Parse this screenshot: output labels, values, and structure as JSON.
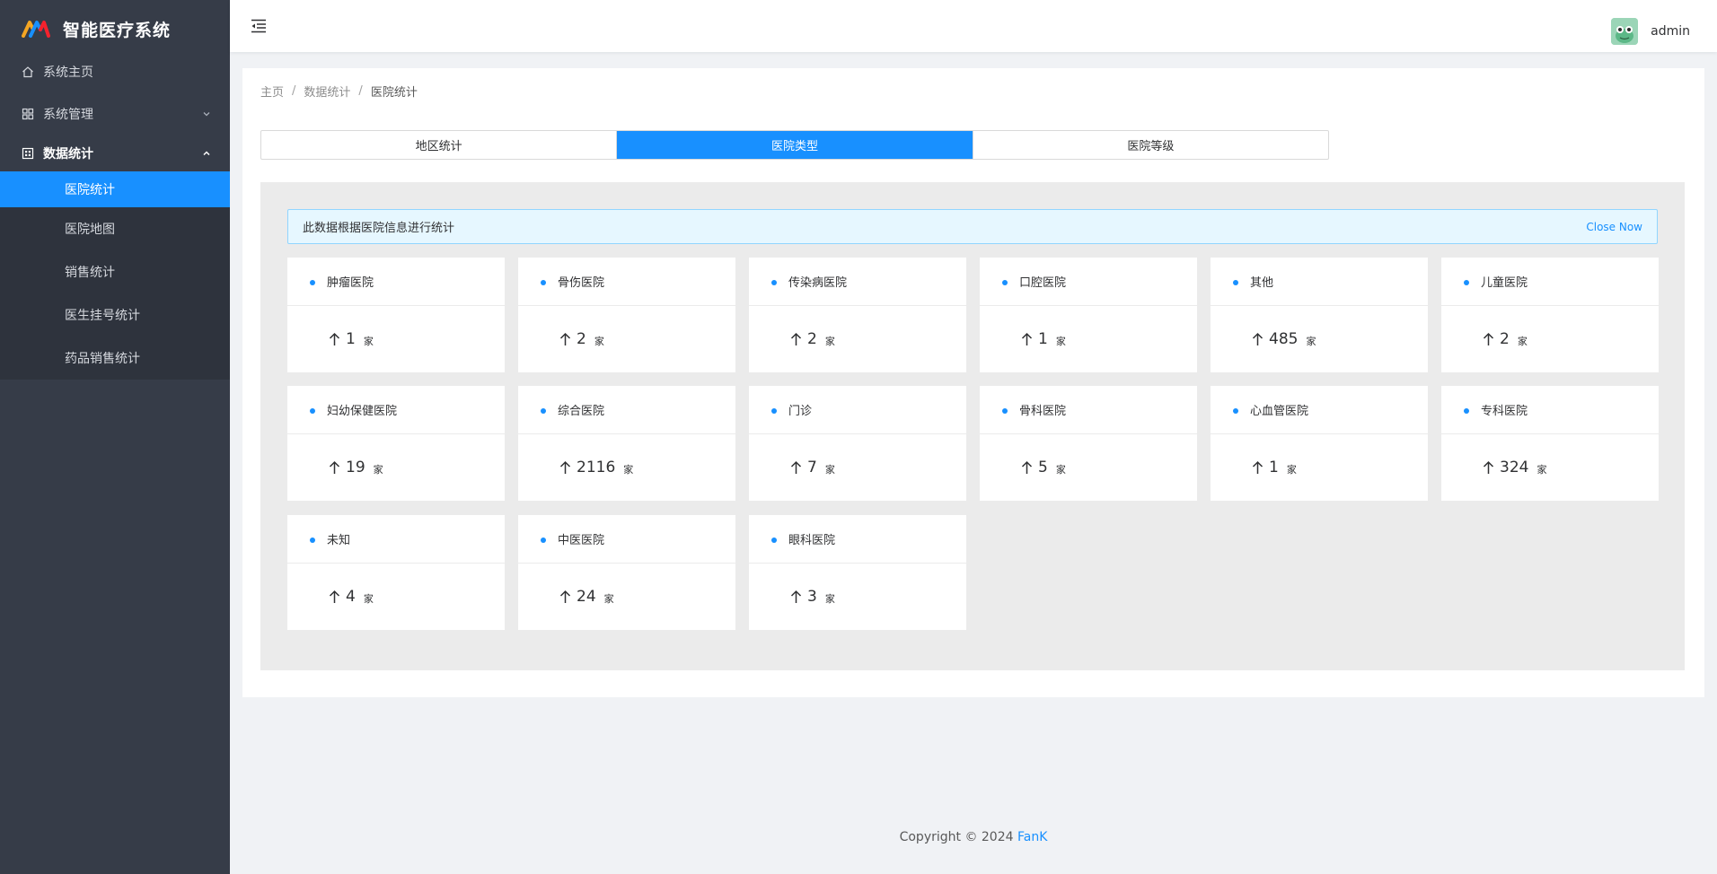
{
  "app": {
    "title": "智能医疗系统"
  },
  "sidebar": {
    "items": [
      {
        "label": "系统主页",
        "icon": "home-icon"
      },
      {
        "label": "系统管理",
        "icon": "grid-icon"
      },
      {
        "label": "数据统计",
        "icon": "chart-grid-icon"
      }
    ],
    "sub_items": [
      {
        "label": "医院统计"
      },
      {
        "label": "医院地图"
      },
      {
        "label": "销售统计"
      },
      {
        "label": "医生挂号统计"
      },
      {
        "label": "药品销售统计"
      }
    ]
  },
  "header": {
    "username": "admin",
    "collapse_icon": "menu-fold-icon",
    "avatar_icon": "frog-avatar-icon"
  },
  "breadcrumb": [
    "主页",
    "数据统计",
    "医院统计"
  ],
  "breadcrumb_sep": "/",
  "tabs": [
    "地区统计",
    "医院类型",
    "医院等级"
  ],
  "alert": {
    "text": "此数据根据医院信息进行统计",
    "close": "Close Now"
  },
  "stats": [
    {
      "name": "肿瘤医院",
      "value": "1",
      "unit": "家"
    },
    {
      "name": "骨伤医院",
      "value": "2",
      "unit": "家"
    },
    {
      "name": "传染病医院",
      "value": "2",
      "unit": "家"
    },
    {
      "name": "口腔医院",
      "value": "1",
      "unit": "家"
    },
    {
      "name": "其他",
      "value": "485",
      "unit": "家"
    },
    {
      "name": "儿童医院",
      "value": "2",
      "unit": "家"
    },
    {
      "name": "妇幼保健医院",
      "value": "19",
      "unit": "家"
    },
    {
      "name": "综合医院",
      "value": "2116",
      "unit": "家"
    },
    {
      "name": "门诊",
      "value": "7",
      "unit": "家"
    },
    {
      "name": "骨科医院",
      "value": "5",
      "unit": "家"
    },
    {
      "name": "心血管医院",
      "value": "1",
      "unit": "家"
    },
    {
      "name": "专科医院",
      "value": "324",
      "unit": "家"
    },
    {
      "name": "未知",
      "value": "4",
      "unit": "家"
    },
    {
      "name": "中医医院",
      "value": "24",
      "unit": "家"
    },
    {
      "name": "眼科医院",
      "value": "3",
      "unit": "家"
    }
  ],
  "footer": {
    "text": "Copyright © 2024",
    "brand": "FanK"
  },
  "colors": {
    "primary": "#1890ff",
    "sidebar_bg": "#363c48",
    "submenu_bg": "#2e333d",
    "panel_bg": "#ebebeb"
  }
}
